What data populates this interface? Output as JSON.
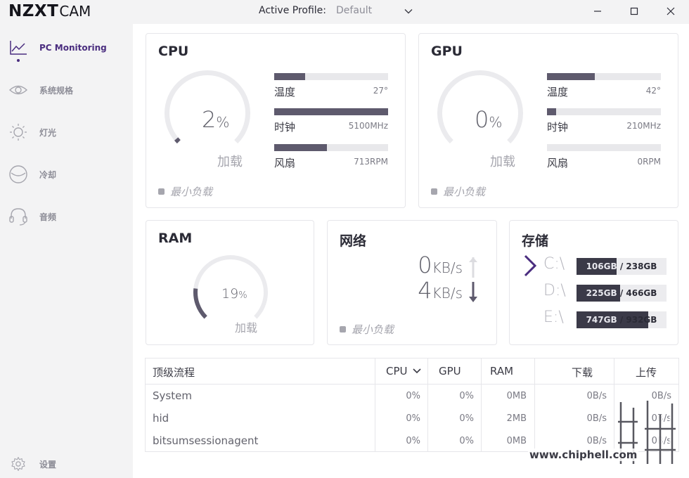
{
  "titlebar": {
    "logo_main": "NZXT",
    "logo_sub": "CAM",
    "profile_label": "Active Profile:",
    "profile_value": "Default"
  },
  "sidebar": {
    "items": [
      {
        "label": "PC Monitoring",
        "icon": "chart-line-icon",
        "active": true
      },
      {
        "label": "系统规格",
        "icon": "eye-icon",
        "active": false
      },
      {
        "label": "灯光",
        "icon": "sun-icon",
        "active": false
      },
      {
        "label": "冷却",
        "icon": "cooling-icon",
        "active": false
      },
      {
        "label": "音频",
        "icon": "headset-icon",
        "active": false
      }
    ],
    "settings_label": "设置"
  },
  "cpu": {
    "title": "CPU",
    "load_value": "2",
    "load_unit": "%",
    "load_fraction": 0.02,
    "load_label": "加载",
    "min_load_label": "最小负载",
    "stats": [
      {
        "label": "温度",
        "value": "27°",
        "fill": 0.27
      },
      {
        "label": "时钟",
        "value": "5100MHz",
        "fill": 1.0
      },
      {
        "label": "风扇",
        "value": "713RPM",
        "fill": 0.46
      }
    ]
  },
  "gpu": {
    "title": "GPU",
    "load_value": "0",
    "load_unit": "%",
    "load_fraction": 0,
    "load_label": "加载",
    "min_load_label": "最小负载",
    "stats": [
      {
        "label": "温度",
        "value": "42°",
        "fill": 0.42
      },
      {
        "label": "时钟",
        "value": "210MHz",
        "fill": 0.08
      },
      {
        "label": "风扇",
        "value": "0RPM",
        "fill": 0
      }
    ]
  },
  "ram": {
    "title": "RAM",
    "load_value": "19",
    "load_unit": "%",
    "load_fraction": 0.19,
    "load_label": "加载"
  },
  "network": {
    "title": "网络",
    "upload_value": "0",
    "download_value": "4",
    "unit": "KB/s",
    "min_load_label": "最小负载"
  },
  "storage": {
    "title": "存储",
    "drives": [
      {
        "letter": "C:\\",
        "used": "106GB",
        "total": "/ 238GB",
        "fill": 0.445
      },
      {
        "letter": "D:\\",
        "used": "225GB",
        "total": "/ 466GB",
        "fill": 0.483
      },
      {
        "letter": "E:\\",
        "used": "747GB",
        "total": "/ 932GB",
        "fill": 0.8
      }
    ]
  },
  "processes": {
    "headers": {
      "name": "顶级流程",
      "cpu": "CPU",
      "gpu": "GPU",
      "ram": "RAM",
      "down": "下载",
      "up": "上传"
    },
    "rows": [
      {
        "name": "System",
        "cpu": "0%",
        "gpu": "0%",
        "ram": "0MB",
        "down": "0B/s",
        "up": "0B/s"
      },
      {
        "name": "hid",
        "cpu": "0%",
        "gpu": "0%",
        "ram": "2MB",
        "down": "0B/s",
        "up": "0B/s"
      },
      {
        "name": "bitsumsessionagent",
        "cpu": "0%",
        "gpu": "0%",
        "ram": "0MB",
        "down": "0B/s",
        "up": "0B/s"
      }
    ]
  },
  "watermark": {
    "text": "www.chiphell.com"
  },
  "colors": {
    "accent": "#4a2d7f",
    "bar_fill": "#5e5a6d",
    "bar_track": "#e8e8eb",
    "drive_fill": "#3b3a48"
  }
}
